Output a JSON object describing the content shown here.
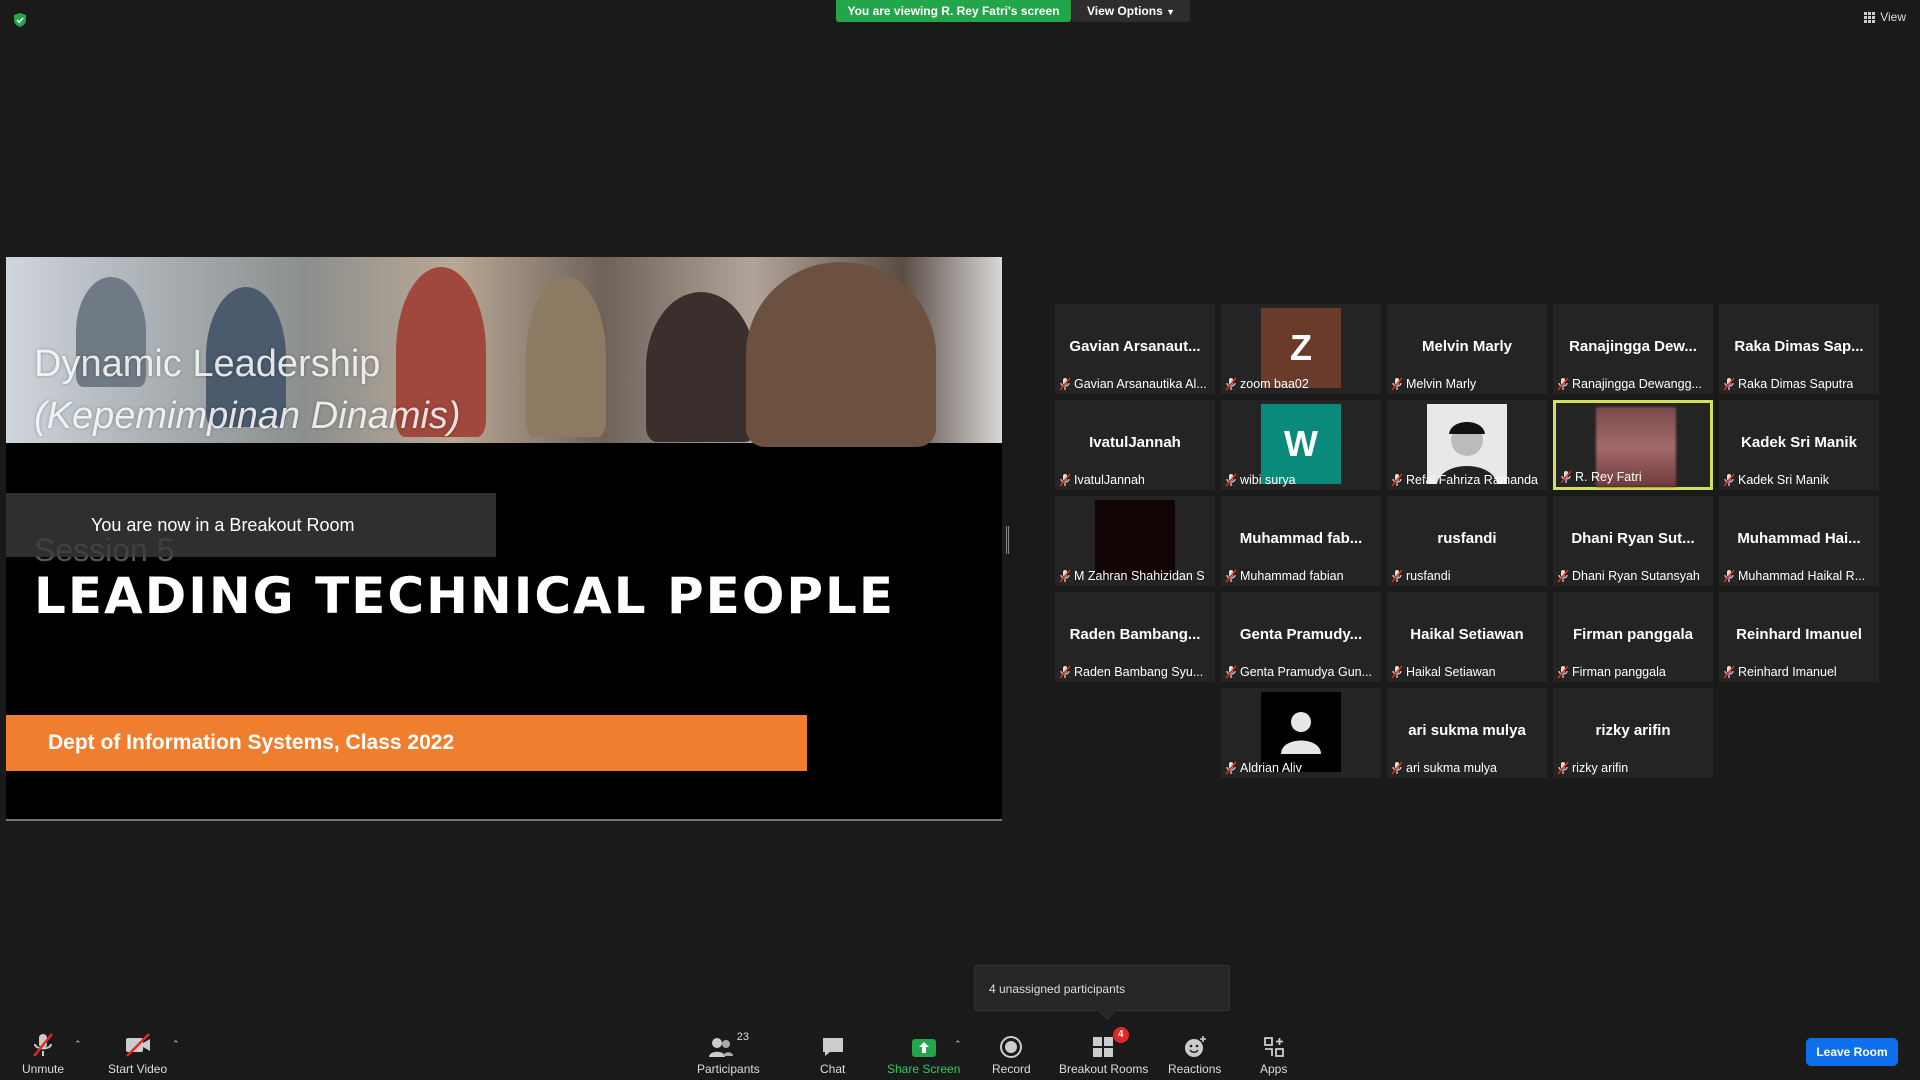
{
  "top": {
    "viewing_banner": "You are viewing R. Rey Fatri's screen",
    "view_options": "View Options",
    "view_button": "View"
  },
  "share": {
    "title_line1": "Dynamic Leadership",
    "title_line2": "(Kepemimpinan Dinamis)",
    "session": "Session 5",
    "heading": "LEADING TECHNICAL PEOPLE",
    "dept": "Dept of Information Systems, Class 2022",
    "toast": "You are now in a Breakout Room"
  },
  "participants": [
    {
      "center": "Gavian  Arsanaut...",
      "label": "Gavian Arsanautika Al..."
    },
    {
      "avatar_letter": "Z",
      "avatar_color": "#6a3b2a",
      "label": "zoom baa02"
    },
    {
      "center": "Melvin Marly",
      "label": "Melvin Marly"
    },
    {
      "center": "Ranajingga  Dew...",
      "label": "Ranajingga Dewangg..."
    },
    {
      "center": "Raka Dimas Sap...",
      "label": "Raka Dimas Saputra"
    },
    {
      "center": "IvatulJannah",
      "label": "IvatulJannah"
    },
    {
      "avatar_letter": "W",
      "avatar_color": "#0a8a7a",
      "label": "wibi surya"
    },
    {
      "avatar": "photo-capped-person",
      "label": "Refal Fahriza Ramanda"
    },
    {
      "avatar": "blurred-video",
      "label": "R. Rey Fatri",
      "active": true
    },
    {
      "center": "Kadek Sri Manik",
      "label": "Kadek Sri Manik"
    },
    {
      "avatar": "dark-video",
      "label": "M Zahran Shahizidan S"
    },
    {
      "center": "Muhammad  fab...",
      "label": "Muhammad fabian"
    },
    {
      "center": "rusfandi",
      "label": "rusfandi"
    },
    {
      "center": "Dhani Ryan Sut...",
      "label": "Dhani Ryan Sutansyah"
    },
    {
      "center": "Muhammad  Hai...",
      "label": "Muhammad Haikal R..."
    },
    {
      "center": "Raden  Bambang...",
      "label": "Raden Bambang Syu..."
    },
    {
      "center": "Genta  Pramudy...",
      "label": "Genta Pramudya Gun..."
    },
    {
      "center": "Haikal Setiawan",
      "label": "Haikal Setiawan"
    },
    {
      "center": "Firman panggala",
      "label": "Firman panggala"
    },
    {
      "center": "Reinhard Imanuel",
      "label": "Reinhard Imanuel"
    },
    {
      "avatar": "default-person",
      "label": "Aldrian Aliv"
    },
    {
      "center": "ari sukma mulya",
      "label": "ari sukma mulya"
    },
    {
      "center": "rizky arifin",
      "label": "rizky arifin"
    }
  ],
  "toolbar": {
    "unmute": "Unmute",
    "start_video": "Start Video",
    "participants": "Participants",
    "participants_count": "23",
    "chat": "Chat",
    "share_screen": "Share Screen",
    "record": "Record",
    "breakout_rooms": "Breakout Rooms",
    "breakout_badge": "4",
    "reactions": "Reactions",
    "apps": "Apps",
    "leave_room": "Leave Room",
    "tooltip": "4 unassigned participants"
  },
  "colors": {
    "share_green": "#23d160",
    "banner_green": "#23a64b",
    "leave_blue": "#0e71eb",
    "active_border": "#d4e157",
    "dept_orange": "#ef7f2e",
    "mute_red": "#e02828"
  }
}
